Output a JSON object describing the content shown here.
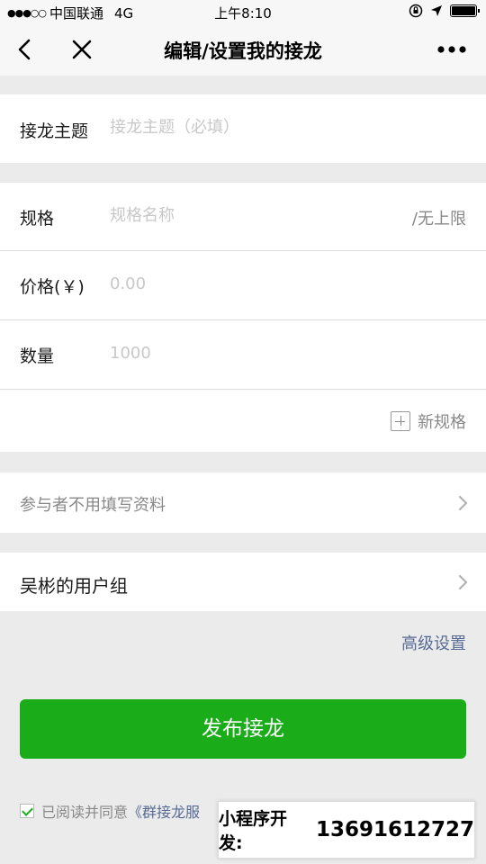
{
  "status_bar": {
    "signal": "●●●○○",
    "carrier": "中国联通",
    "network": "4G",
    "time": "上午8:10"
  },
  "nav": {
    "title": "编辑/设置我的接龙"
  },
  "topic": {
    "label": "接龙主题",
    "placeholder": "接龙主题（必填）"
  },
  "spec": {
    "label": "规格",
    "placeholder": "规格名称",
    "suffix": "/无上限"
  },
  "price": {
    "label": "价格(￥)",
    "placeholder": "0.00"
  },
  "quantity": {
    "label": "数量",
    "placeholder": "1000"
  },
  "add_spec_label": "新规格",
  "participant_option": "参与者不用填写资料",
  "user_group": "吴彬的用户组",
  "advanced_label": "高级设置",
  "publish_label": "发布接龙",
  "agree": {
    "text": "已阅读并同意",
    "link": "《群接龙服"
  },
  "watermark": {
    "label": "小程序开发:",
    "phone": "13691612727"
  },
  "colors": {
    "primary_green": "#1aad19",
    "link_blue": "#576b95",
    "background": "#ebebeb"
  }
}
